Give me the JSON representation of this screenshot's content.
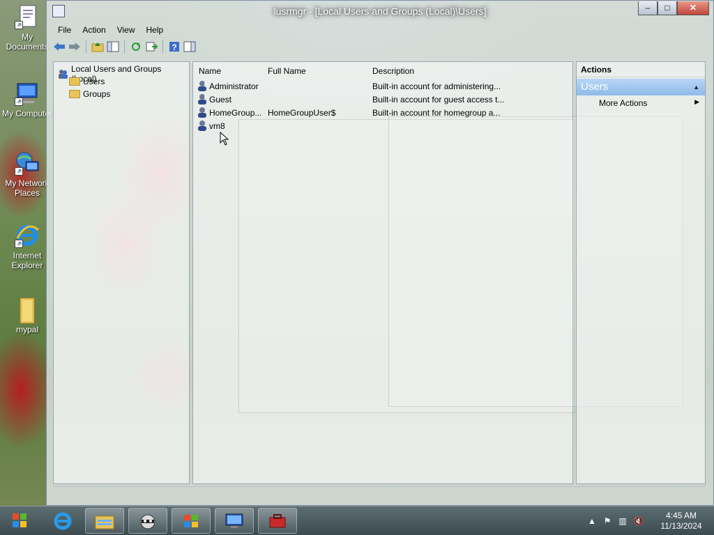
{
  "desktop": {
    "icons": [
      {
        "label": "My Documents",
        "icon": "my-documents-icon"
      },
      {
        "label": "My Computer",
        "icon": "my-computer-icon"
      },
      {
        "label": "My Network Places",
        "icon": "network-places-icon"
      },
      {
        "label": "Internet Explorer",
        "icon": "internet-explorer-icon"
      },
      {
        "label": "mypal",
        "icon": "folder-icon"
      }
    ]
  },
  "window": {
    "title": "lusrmgr - [Local Users and Groups (Local)\\Users]",
    "caption": {
      "minimize": "‒",
      "maximize": "□",
      "close": "✕"
    },
    "menu": [
      "File",
      "Action",
      "View",
      "Help"
    ]
  },
  "tree": {
    "root": "Local Users and Groups (Local)",
    "children": [
      "Users",
      "Groups"
    ]
  },
  "list": {
    "columns": [
      "Name",
      "Full Name",
      "Description"
    ],
    "rows": [
      {
        "name": "Administrator",
        "full_name": "",
        "description": "Built-in account for administering..."
      },
      {
        "name": "Guest",
        "full_name": "",
        "description": "Built-in account for guest access t..."
      },
      {
        "name": "HomeGroup...",
        "full_name": "HomeGroupUser$",
        "description": "Built-in account for homegroup a..."
      },
      {
        "name": "vm8",
        "full_name": "",
        "description": ""
      }
    ]
  },
  "actions": {
    "header": "Actions",
    "selected": "Users",
    "items": [
      "More Actions"
    ]
  },
  "taskbar": {
    "time": "4:45 AM",
    "date": "11/13/2024"
  },
  "colors": {
    "selection": "#8fbbe9",
    "taskbar": "#3a4a4f"
  }
}
